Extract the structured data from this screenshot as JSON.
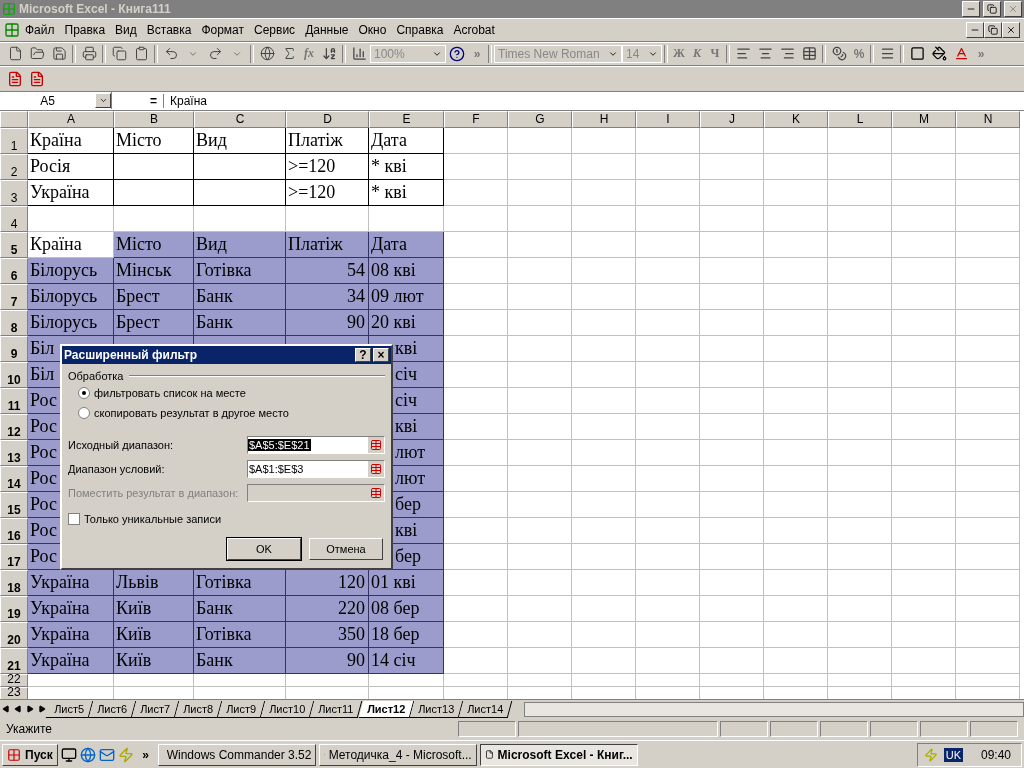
{
  "window": {
    "title": "Microsoft Excel - Книга111",
    "active": false
  },
  "menu": [
    "Файл",
    "Правка",
    "Вид",
    "Вставка",
    "Формат",
    "Сервис",
    "Данные",
    "Окно",
    "Справка",
    "Acrobat"
  ],
  "toolbar": {
    "function_label": "fx",
    "zoom": "100%",
    "more": "»",
    "font": "Times New Roman",
    "size": "14",
    "format_buttons": [
      "Ж",
      "К",
      "Ч"
    ],
    "percent": "%",
    "more_right": "»"
  },
  "formula_bar": {
    "name_box": "A5",
    "equals": "=",
    "content": "Країна"
  },
  "columns": [
    "A",
    "B",
    "C",
    "D",
    "E",
    "F",
    "G",
    "H",
    "I",
    "J",
    "K",
    "L",
    "M",
    "N"
  ],
  "rows": [
    {
      "num": "1",
      "kind": "criteria",
      "selected": false,
      "cells": [
        "Країна",
        "Місто",
        "Вид",
        "Платіж",
        "Дата"
      ]
    },
    {
      "num": "2",
      "kind": "criteria",
      "selected": false,
      "cells": [
        "Росія",
        "",
        "",
        ">=120",
        "* кві"
      ]
    },
    {
      "num": "3",
      "kind": "criteria",
      "selected": false,
      "cells": [
        "Україна",
        "",
        "",
        ">=120",
        "* кві"
      ]
    },
    {
      "num": "4",
      "kind": "empty",
      "selected": false
    },
    {
      "num": "5",
      "kind": "header",
      "selected": true,
      "active": true,
      "cells": [
        "Країна",
        "Місто",
        "Вид",
        "Платіж",
        "Дата"
      ]
    },
    {
      "num": "6",
      "kind": "record",
      "selected": true,
      "cells": [
        "Білорусь",
        "Мінськ",
        "Готівка",
        "54",
        "08 кві"
      ]
    },
    {
      "num": "7",
      "kind": "record",
      "selected": true,
      "cells": [
        "Білорусь",
        "Брест",
        "Банк",
        "34",
        "09 лют"
      ]
    },
    {
      "num": "8",
      "kind": "record",
      "selected": true,
      "cells": [
        "Білорусь",
        "Брест",
        "Банк",
        "90",
        "20 кві"
      ]
    },
    {
      "num": "9",
      "kind": "covered",
      "selected": true,
      "cells": [
        "Біл",
        "кві"
      ]
    },
    {
      "num": "10",
      "kind": "covered",
      "selected": true,
      "cells": [
        "Біл",
        "січ"
      ]
    },
    {
      "num": "11",
      "kind": "covered",
      "selected": true,
      "cells": [
        "Рос",
        "січ"
      ]
    },
    {
      "num": "12",
      "kind": "covered",
      "selected": true,
      "cells": [
        "Рос",
        "кві"
      ]
    },
    {
      "num": "13",
      "kind": "covered",
      "selected": true,
      "cells": [
        "Рос",
        "лют"
      ]
    },
    {
      "num": "14",
      "kind": "covered",
      "selected": true,
      "cells": [
        "Рос",
        "лют"
      ]
    },
    {
      "num": "15",
      "kind": "covered",
      "selected": true,
      "cells": [
        "Рос",
        "бер"
      ]
    },
    {
      "num": "16",
      "kind": "covered",
      "selected": true,
      "cells": [
        "Рос",
        "кві"
      ]
    },
    {
      "num": "17",
      "kind": "covered",
      "selected": true,
      "cells": [
        "Рос",
        "бер"
      ]
    },
    {
      "num": "18",
      "kind": "record",
      "selected": true,
      "cells": [
        "Україна",
        "Львів",
        "Готівка",
        "120",
        "01 кві"
      ]
    },
    {
      "num": "19",
      "kind": "record",
      "selected": true,
      "cells": [
        "Україна",
        "Київ",
        "Банк",
        "220",
        "08 бер"
      ]
    },
    {
      "num": "20",
      "kind": "record",
      "selected": true,
      "cells": [
        "Україна",
        "Київ",
        "Готівка",
        "350",
        "18 бер"
      ]
    },
    {
      "num": "21",
      "kind": "record",
      "selected": true,
      "cells": [
        "Україна",
        "Київ",
        "Банк",
        "90",
        "14 січ"
      ]
    },
    {
      "num": "22",
      "kind": "short",
      "selected": false
    },
    {
      "num": "23",
      "kind": "short",
      "selected": false
    }
  ],
  "dialog": {
    "title": "Расширенный фильтр",
    "help": "?",
    "close": "×",
    "group": "Обработка",
    "options": [
      {
        "label": "фильтровать список на месте",
        "selected": true
      },
      {
        "label": "скопировать результат в другое место",
        "selected": false
      }
    ],
    "fields": [
      {
        "label": "Исходный диапазон:",
        "value": "$A$5:$E$21",
        "disabled": false,
        "highlighted": true
      },
      {
        "label": "Диапазон условий:",
        "value": "$A$1:$E$3",
        "disabled": false,
        "highlighted": false
      },
      {
        "label": "Поместить результат в диапазон:",
        "disabled": true
      }
    ],
    "checkbox": {
      "label": "Только уникальные записи",
      "checked": false
    },
    "buttons": [
      "OK",
      "Отмена"
    ]
  },
  "sheet_tabs": [
    {
      "label": "Лист5",
      "selected": false
    },
    {
      "label": "Лист6",
      "selected": false
    },
    {
      "label": "Лист7",
      "selected": false
    },
    {
      "label": "Лист8",
      "selected": false
    },
    {
      "label": "Лист9",
      "selected": false
    },
    {
      "label": "Лист10",
      "selected": false
    },
    {
      "label": "Лист11",
      "selected": false
    },
    {
      "label": "Лист12",
      "selected": true
    },
    {
      "label": "Лист13",
      "selected": false
    },
    {
      "label": "Лист14",
      "selected": false
    }
  ],
  "status_bar": {
    "text": "Укажите"
  },
  "taskbar": {
    "start": "Пуск",
    "more": "»",
    "tasks": [
      {
        "label": "Windows Commander 3.52",
        "selected": false
      },
      {
        "label": "Методичка_4 - Microsoft...",
        "selected": false
      },
      {
        "label": "Microsoft Excel - Книг...",
        "selected": true
      }
    ],
    "lang": "UK",
    "clock": "09:40"
  }
}
